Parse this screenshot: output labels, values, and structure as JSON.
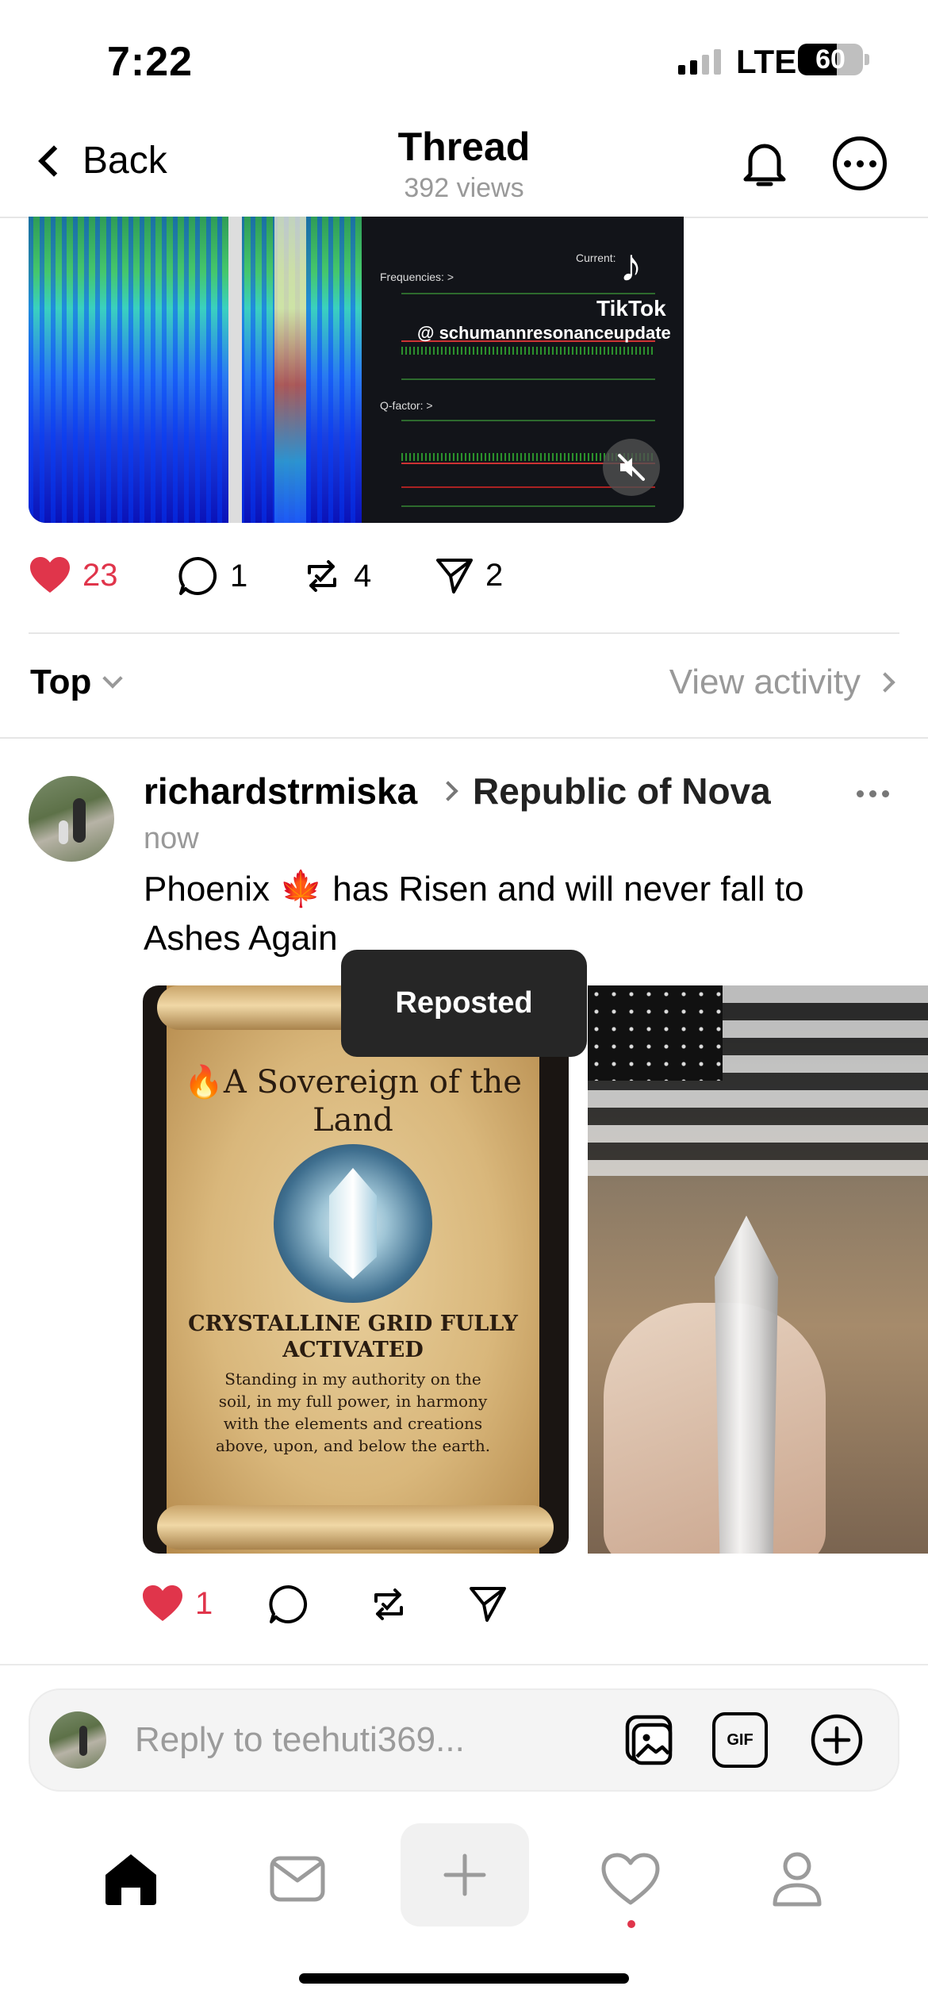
{
  "status_bar": {
    "time": "7:22",
    "network": "LTE",
    "battery": "60"
  },
  "nav": {
    "back_label": "Back",
    "title": "Thread",
    "views": "392 views"
  },
  "video": {
    "tiktok_text": "TikTok",
    "tiktok_handle": "@ schumannresonanceupdate",
    "current_label": "Current:",
    "freq_label": "Frequencies: >",
    "q_label": "Q-factor: >"
  },
  "main_actions": {
    "likes": "23",
    "replies": "1",
    "reposts": "4",
    "shares": "2"
  },
  "sort": {
    "label": "Top",
    "view_activity": "View activity"
  },
  "post": {
    "username": "richardstrmiska",
    "community": "Republic of Nova",
    "timestamp": "now",
    "text_before": "Phoenix ",
    "emoji": "🍁",
    "text_after": " has Risen and will never fall to Ashes Again",
    "toast": "Reposted",
    "scroll_title": "🔥A Sovereign of the Land",
    "scroll_heading": "CRYSTALLINE GRID FULLY ACTIVATED",
    "scroll_body": "Standing in my authority on the soil, in my full power, in harmony with the elements and creations above, upon, and below the earth.",
    "likes": "1"
  },
  "reply_bar": {
    "placeholder": "Reply to teehuti369...",
    "gif_label": "GIF"
  },
  "colors": {
    "like_red": "#e0354b",
    "muted": "#999999"
  },
  "icons": [
    "back-chevron-icon",
    "bell-icon",
    "more-icon",
    "heart-icon",
    "comment-icon",
    "repost-icon",
    "share-icon",
    "home-icon",
    "inbox-icon",
    "plus-icon",
    "activity-heart-icon",
    "profile-icon",
    "gallery-icon",
    "gif-icon",
    "add-circle-icon",
    "mute-icon"
  ]
}
